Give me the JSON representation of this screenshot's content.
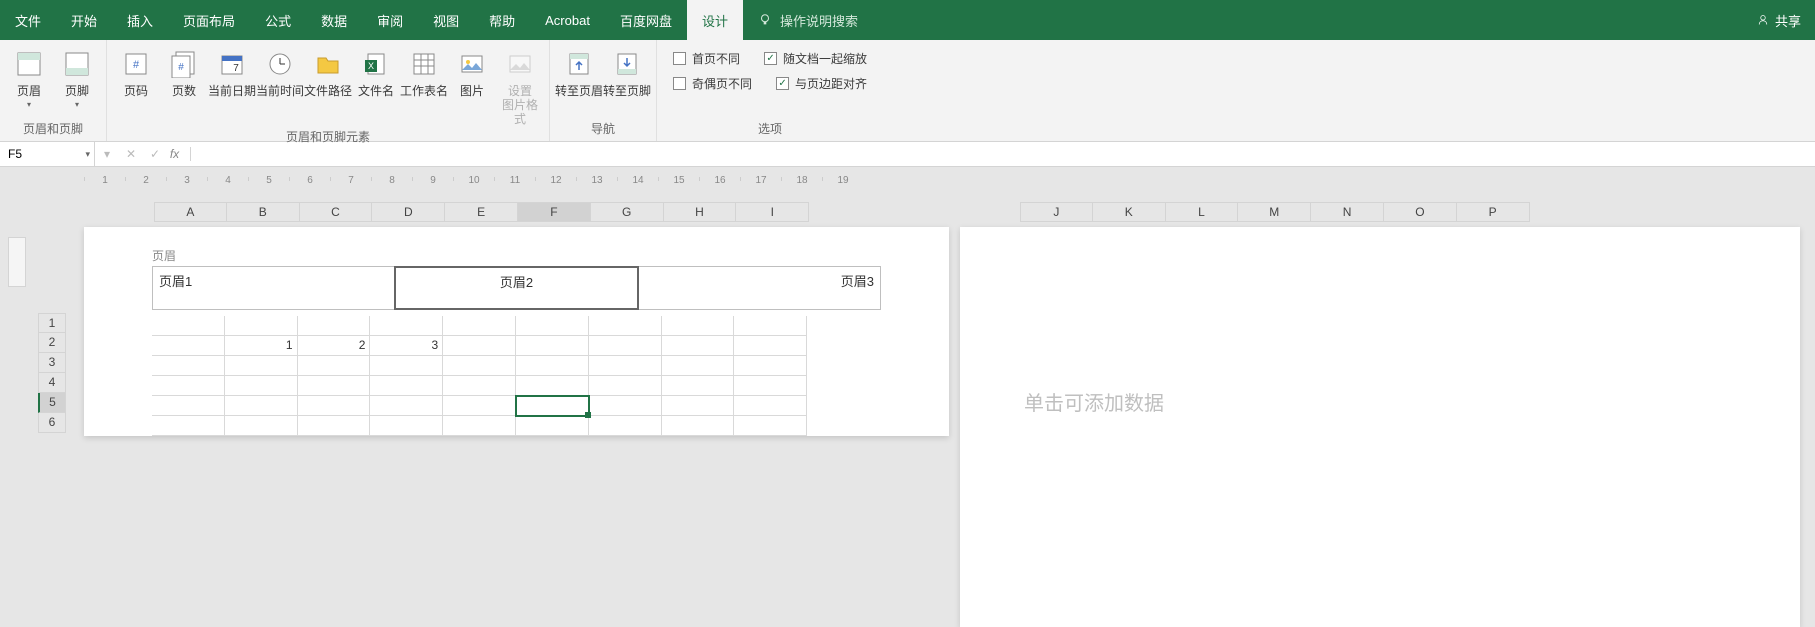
{
  "menu": {
    "tabs": [
      "文件",
      "开始",
      "插入",
      "页面布局",
      "公式",
      "数据",
      "审阅",
      "视图",
      "帮助",
      "Acrobat",
      "百度网盘",
      "设计"
    ],
    "active_index": 11,
    "search_placeholder": "操作说明搜索",
    "share": "共享"
  },
  "ribbon": {
    "groups": [
      {
        "label": "页眉和页脚",
        "buttons": [
          {
            "l": "页眉",
            "a": true
          },
          {
            "l": "页脚",
            "a": true
          }
        ]
      },
      {
        "label": "页眉和页脚元素",
        "buttons": [
          {
            "l": "页码"
          },
          {
            "l": "页数"
          },
          {
            "l": "当前日期"
          },
          {
            "l": "当前时间"
          },
          {
            "l": "文件路径"
          },
          {
            "l": "文件名"
          },
          {
            "l": "工作表名"
          },
          {
            "l": "图片"
          },
          {
            "l": "设置\n图片格式",
            "dis": true
          }
        ]
      },
      {
        "label": "导航",
        "buttons": [
          {
            "l": "转至页眉"
          },
          {
            "l": "转至页脚"
          }
        ]
      },
      {
        "label": "选项",
        "checks": [
          [
            {
              "l": "首页不同",
              "c": false
            },
            {
              "l": "随文档一起缩放",
              "c": true
            }
          ],
          [
            {
              "l": "奇偶页不同",
              "c": false
            },
            {
              "l": "与页边距对齐",
              "c": true
            }
          ]
        ]
      }
    ]
  },
  "formula_bar": {
    "cell_ref": "F5"
  },
  "ruler_ticks": [
    "1",
    "2",
    "3",
    "4",
    "5",
    "6",
    "7",
    "8",
    "9",
    "10",
    "11",
    "12",
    "13",
    "14",
    "15",
    "16",
    "17",
    "18",
    "19"
  ],
  "cols_page1": [
    "A",
    "B",
    "C",
    "D",
    "E",
    "F",
    "G",
    "H",
    "I"
  ],
  "cols_page2": [
    "J",
    "K",
    "L",
    "M",
    "N",
    "O",
    "P"
  ],
  "selected_col": "F",
  "rows": [
    "1",
    "2",
    "3",
    "4",
    "5",
    "6"
  ],
  "selected_row": "5",
  "header": {
    "label": "页眉",
    "left": "页眉1",
    "center": "页眉2",
    "right": "页眉3"
  },
  "cells": {
    "r2": [
      "",
      "1",
      "2",
      "3",
      "",
      "",
      "",
      "",
      "",
      ""
    ]
  },
  "page2_placeholder": "单击可添加数据"
}
